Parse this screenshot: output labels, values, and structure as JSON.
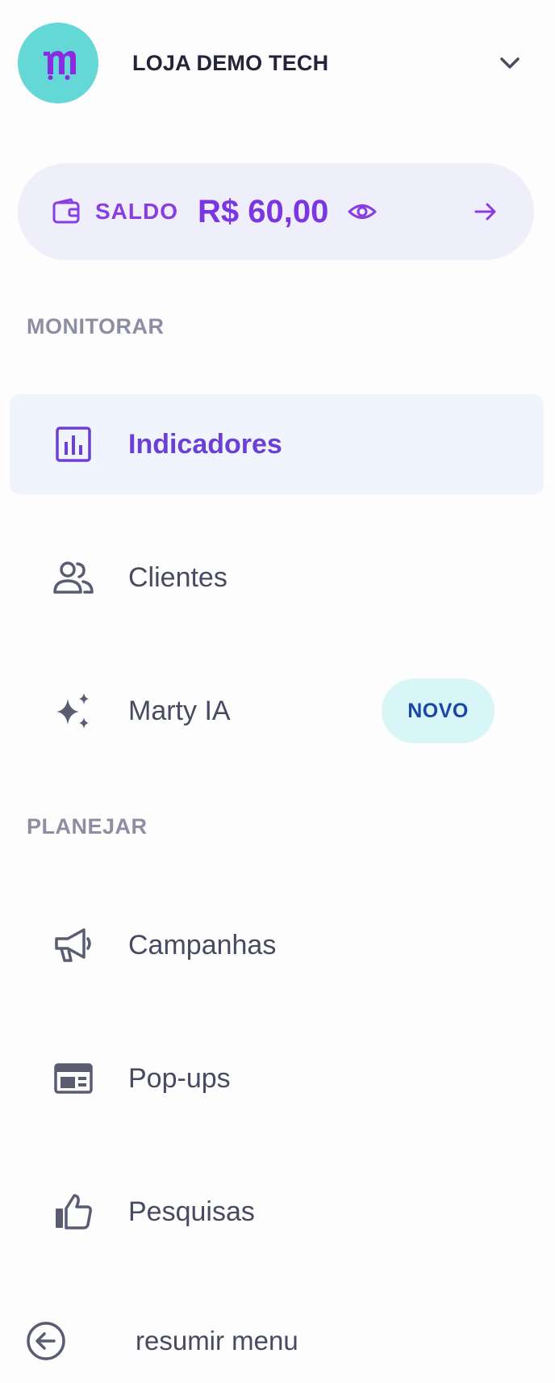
{
  "header": {
    "store_name": "LOJA DEMO TECH",
    "avatar_color": "#64d8d6",
    "avatar_icon": "m-logo-icon",
    "dropdown_icon": "chevron-down-icon"
  },
  "balance": {
    "label": "SALDO",
    "value": "R$ 60,00",
    "wallet_icon": "wallet-icon",
    "visibility_icon": "eye-icon",
    "go_icon": "arrow-right-icon",
    "accent_color": "#7a36e0"
  },
  "sections": {
    "monitor_label": "MONITORAR",
    "plan_label": "PLANEJAR"
  },
  "nav": {
    "indicadores": {
      "label": "Indicadores",
      "icon": "bar-chart-icon",
      "active": true
    },
    "clientes": {
      "label": "Clientes",
      "icon": "users-icon"
    },
    "marty": {
      "label": "Marty IA",
      "icon": "sparkles-icon",
      "badge": "NOVO"
    },
    "campanhas": {
      "label": "Campanhas",
      "icon": "megaphone-icon"
    },
    "popups": {
      "label": "Pop-ups",
      "icon": "popup-layout-icon"
    },
    "pesquisas": {
      "label": "Pesquisas",
      "icon": "thumbs-up-icon"
    }
  },
  "footer": {
    "collapse_label": "resumir menu",
    "collapse_icon": "arrow-left-circle-icon"
  }
}
